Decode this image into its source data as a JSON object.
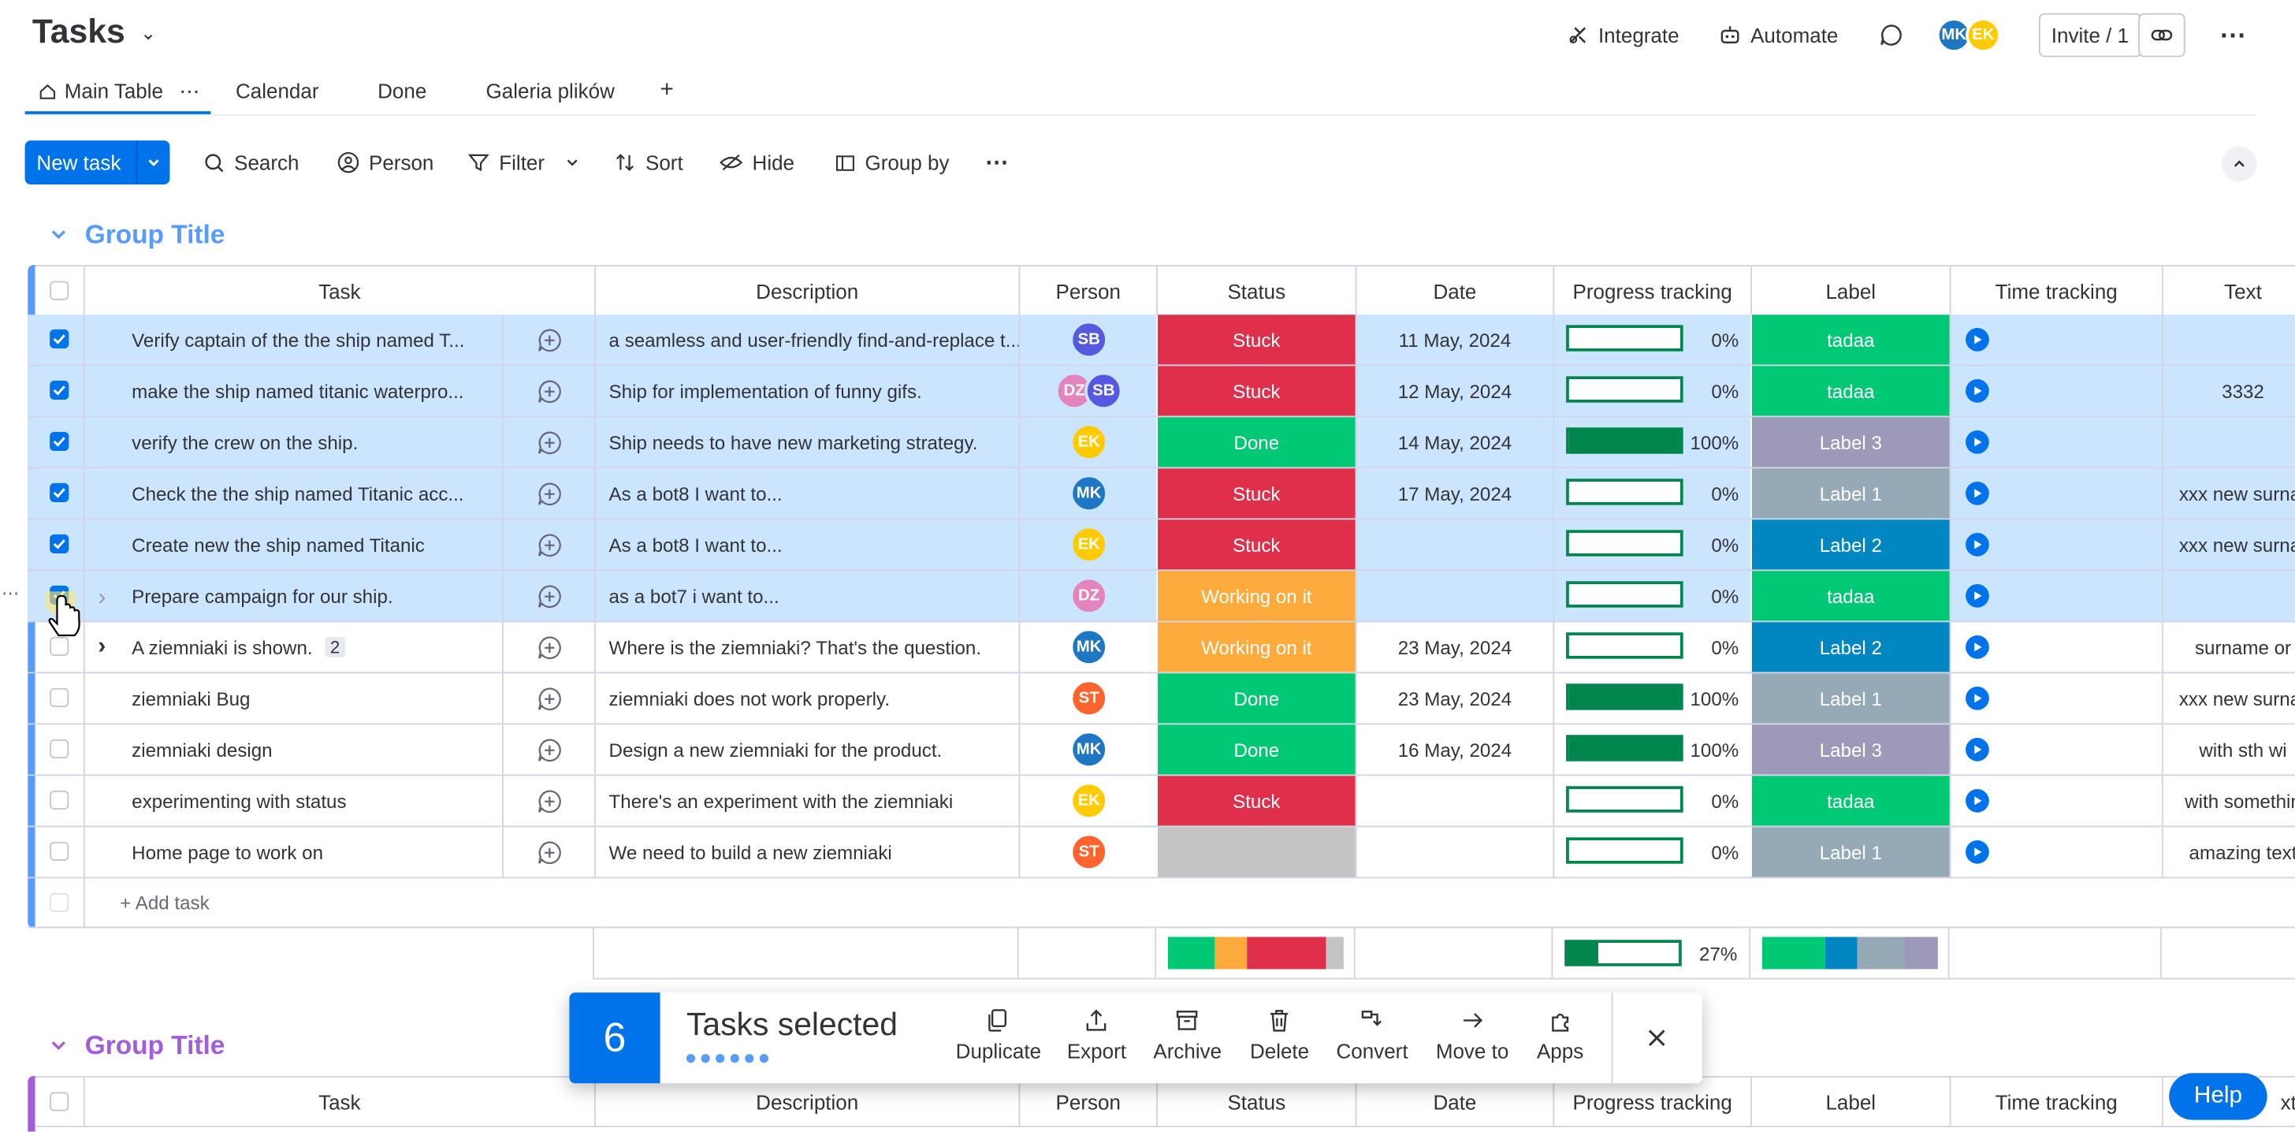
{
  "header": {
    "title": "Tasks",
    "integrate": "Integrate",
    "automate": "Automate",
    "avatars": [
      {
        "initials": "MK",
        "color": "#1f76c2"
      },
      {
        "initials": "EK",
        "color": "#ffcb00"
      }
    ],
    "invite": "Invite / 1"
  },
  "tabs": [
    {
      "label": "Main Table"
    },
    {
      "label": "Calendar"
    },
    {
      "label": "Done"
    },
    {
      "label": "Galeria plików"
    }
  ],
  "tabs_add": "+",
  "toolbar": {
    "new_task": "New task",
    "search": "Search",
    "person": "Person",
    "filter": "Filter",
    "sort": "Sort",
    "hide": "Hide",
    "group_by": "Group by"
  },
  "group1": {
    "title": "Group Title",
    "color": "#579bfc",
    "columns": [
      "Task",
      "Description",
      "Person",
      "Status",
      "Date",
      "Progress tracking",
      "Label",
      "Time tracking",
      "Text"
    ],
    "rows": [
      {
        "selected": true,
        "task": "Verify captain of the the ship named T...",
        "desc": "a seamless and user-friendly find-and-replace t...",
        "person": [
          {
            "i": "SB",
            "c": "#5559df"
          }
        ],
        "status": "Stuck",
        "status_color": "#df2f4a",
        "date": "11 May, 2024",
        "progress": 0,
        "pct": "0%",
        "label": "tadaa",
        "label_color": "#00c875",
        "text": ""
      },
      {
        "selected": true,
        "task": "make the ship named titanic waterpro...",
        "desc": "Ship for implementation of funny gifs.",
        "person": [
          {
            "i": "DZ",
            "c": "#e484bd"
          },
          {
            "i": "SB",
            "c": "#5559df"
          }
        ],
        "status": "Stuck",
        "status_color": "#df2f4a",
        "date": "12 May, 2024",
        "progress": 0,
        "pct": "0%",
        "label": "tadaa",
        "label_color": "#00c875",
        "text": "3332"
      },
      {
        "selected": true,
        "task": "verify the crew on the ship.",
        "desc": "Ship needs to have new marketing strategy.",
        "person": [
          {
            "i": "EK",
            "c": "#ffcb00"
          }
        ],
        "status": "Done",
        "status_color": "#00c875",
        "date": "14 May, 2024",
        "progress": 1,
        "pct": "100%",
        "label": "Label 3",
        "label_color": "#9d99b9",
        "text": ""
      },
      {
        "selected": true,
        "task": "Check the the ship named Titanic acc...",
        "desc": "As a bot8 I want to...",
        "person": [
          {
            "i": "MK",
            "c": "#1f76c2"
          }
        ],
        "status": "Stuck",
        "status_color": "#df2f4a",
        "date": "17 May, 2024",
        "progress": 0,
        "pct": "0%",
        "label": "Label 1",
        "label_color": "#95a9b7",
        "text": "xxx new surnar"
      },
      {
        "selected": true,
        "task": "Create new the ship named Titanic",
        "desc": "As a bot8 I want to...",
        "person": [
          {
            "i": "EK",
            "c": "#ffcb00"
          }
        ],
        "status": "Stuck",
        "status_color": "#df2f4a",
        "date": "",
        "progress": 0,
        "pct": "0%",
        "label": "Label 2",
        "label_color": "#0086c0",
        "text": "xxx new surnar"
      },
      {
        "selected": true,
        "task": "Prepare campaign for our ship.",
        "desc": "as a bot7 i want to...",
        "person": [
          {
            "i": "DZ",
            "c": "#e484bd"
          }
        ],
        "status": "Working on it",
        "status_color": "#fdab3d",
        "date": "",
        "progress": 0,
        "pct": "0%",
        "label": "tadaa",
        "label_color": "#00c875",
        "text": ""
      },
      {
        "selected": false,
        "task": "A ziemniaki is shown.",
        "subitems": "2",
        "desc": "Where is the ziemniaki? That's the question.",
        "person": [
          {
            "i": "MK",
            "c": "#1f76c2"
          }
        ],
        "status": "Working on it",
        "status_color": "#fdab3d",
        "date": "23 May, 2024",
        "progress": 0,
        "pct": "0%",
        "label": "Label 2",
        "label_color": "#0086c0",
        "text": "surname or"
      },
      {
        "selected": false,
        "task": "ziemniaki Bug",
        "desc": "ziemniaki does not work properly.",
        "person": [
          {
            "i": "ST",
            "c": "#ff642e"
          }
        ],
        "status": "Done",
        "status_color": "#00c875",
        "date": "23 May, 2024",
        "progress": 1,
        "pct": "100%",
        "label": "Label 1",
        "label_color": "#95a9b7",
        "text": "xxx new surnar"
      },
      {
        "selected": false,
        "task": "ziemniaki design",
        "desc": "Design a new ziemniaki for the product.",
        "person": [
          {
            "i": "MK",
            "c": "#1f76c2"
          }
        ],
        "status": "Done",
        "status_color": "#00c875",
        "date": "16 May, 2024",
        "progress": 1,
        "pct": "100%",
        "label": "Label 3",
        "label_color": "#9d99b9",
        "text": "with sth wi"
      },
      {
        "selected": false,
        "task": "experimenting with status",
        "desc": "There's an experiment with the ziemniaki",
        "person": [
          {
            "i": "EK",
            "c": "#ffcb00"
          }
        ],
        "status": "Stuck",
        "status_color": "#df2f4a",
        "date": "",
        "progress": 0,
        "pct": "0%",
        "label": "tadaa",
        "label_color": "#00c875",
        "text": "with somethin"
      },
      {
        "selected": false,
        "task": "Home page to work on",
        "desc": "We need to build a new ziemniaki",
        "person": [
          {
            "i": "ST",
            "c": "#ff642e"
          }
        ],
        "status": "",
        "status_color": "#c4c4c4",
        "date": "",
        "progress": 0,
        "pct": "0%",
        "label": "Label 1",
        "label_color": "#95a9b7",
        "text": "amazing text"
      }
    ],
    "add_task": "+ Add task",
    "summary_pct": "27%",
    "summary_progress": 0.27,
    "status_summary": [
      {
        "color": "#00c875",
        "share": 0.27
      },
      {
        "color": "#fdab3d",
        "share": 0.18
      },
      {
        "color": "#df2f4a",
        "share": 0.45
      },
      {
        "color": "#c4c4c4",
        "share": 0.1
      }
    ],
    "label_summary": [
      {
        "color": "#00c875",
        "share": 0.36
      },
      {
        "color": "#0086c0",
        "share": 0.18
      },
      {
        "color": "#95a9b7",
        "share": 0.27
      },
      {
        "color": "#9d99b9",
        "share": 0.19
      }
    ]
  },
  "group2": {
    "title": "Group Title",
    "color": "#a25ddc",
    "columns": [
      "Task",
      "Description",
      "Person",
      "Status",
      "Date",
      "Progress tracking",
      "Label",
      "Time tracking",
      "xt"
    ]
  },
  "selection_bar": {
    "count": "6",
    "label": "Tasks selected",
    "actions": [
      {
        "label": "Duplicate",
        "icon": "duplicate-icon"
      },
      {
        "label": "Export",
        "icon": "export-icon"
      },
      {
        "label": "Archive",
        "icon": "archive-icon"
      },
      {
        "label": "Delete",
        "icon": "trash-icon"
      },
      {
        "label": "Convert",
        "icon": "convert-icon"
      },
      {
        "label": "Move to",
        "icon": "arrow-right-icon"
      },
      {
        "label": "Apps",
        "icon": "apps-icon"
      }
    ]
  },
  "help": "Help"
}
